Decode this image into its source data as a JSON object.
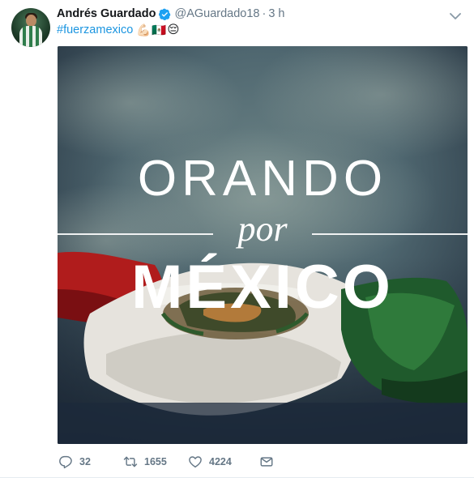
{
  "tweet": {
    "author": {
      "name": "Andrés Guardado",
      "verified": true,
      "handle": "@AGuardado18",
      "separator": "·",
      "time": "3 h"
    },
    "text": {
      "hashtag": "#fuerzamexico",
      "emojis": [
        "💪🏻",
        "🇲🇽",
        "😔"
      ]
    },
    "media": {
      "line1": "ORANDO",
      "line2": "por",
      "line3": "MÉXICO",
      "colors": {
        "sky": "#4f6770",
        "flag_green": "#1f5a2c",
        "flag_white": "#e6e3dd",
        "flag_red": "#b01c1c"
      }
    },
    "actions": {
      "replies": "32",
      "retweets": "1655",
      "likes": "4224"
    }
  },
  "icons": {
    "verified": "verified-badge-icon",
    "caret": "chevron-down-icon",
    "reply": "reply-icon",
    "retweet": "retweet-icon",
    "like": "heart-icon",
    "dm": "envelope-icon"
  },
  "colors": {
    "link": "#1b95e0",
    "muted": "#657786",
    "text": "#14171a"
  }
}
